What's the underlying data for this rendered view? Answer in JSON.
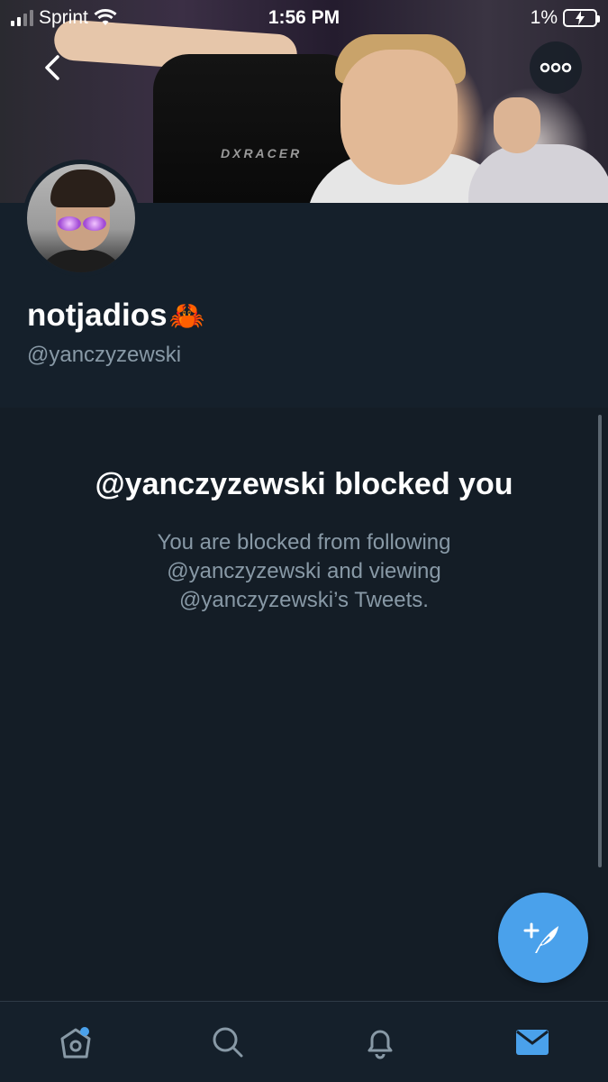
{
  "status_bar": {
    "carrier": "Sprint",
    "time": "1:56 PM",
    "battery_percent": "1%",
    "signal_bars": 2
  },
  "profile": {
    "display_name": "notjadios",
    "name_emoji": "🦀",
    "handle": "@yanczyzewski",
    "banner_text": "DXRACER"
  },
  "blocked": {
    "title": "@yanczyzewski blocked you",
    "description": "You are blocked from following @yanczyzewski and viewing @yanczyzewski’s Tweets."
  },
  "tabs": [
    {
      "icon": "home-icon",
      "active": false,
      "has_badge": true
    },
    {
      "icon": "search-icon",
      "active": false
    },
    {
      "icon": "bell-icon",
      "active": false
    },
    {
      "icon": "mail-icon",
      "active": true
    }
  ],
  "colors": {
    "accent": "#4aa1eb",
    "background": "#141d26",
    "header_background": "#15202b",
    "secondary_text": "#8899a6"
  }
}
